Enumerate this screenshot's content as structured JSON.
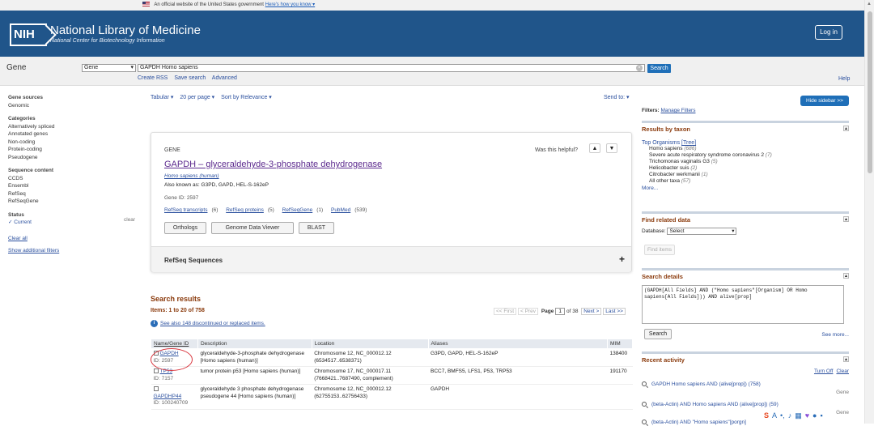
{
  "gov_banner": {
    "text": "An official website of the United States government",
    "link": "Here's how you know ▾"
  },
  "header": {
    "logo": "NIH",
    "title": "National Library of Medicine",
    "subtitle": "National Center for Biotechnology Information",
    "login": "Log in"
  },
  "search": {
    "db_title": "Gene",
    "db_select": "Gene",
    "query": "GAPDH Homo sapiens",
    "button": "Search",
    "links": [
      "Create RSS",
      "Save search",
      "Advanced"
    ],
    "help": "Help"
  },
  "sidebar": {
    "gene_sources": {
      "heading": "Gene sources",
      "items": [
        "Genomic"
      ]
    },
    "categories": {
      "heading": "Categories",
      "items": [
        "Alternatively spliced",
        "Annotated genes",
        "Non-coding",
        "Protein-coding",
        "Pseudogene"
      ]
    },
    "sequence": {
      "heading": "Sequence content",
      "items": [
        "CCDS",
        "Ensembl",
        "RefSeq",
        "RefSeqGene"
      ]
    },
    "status": {
      "heading": "Status",
      "clear": "clear",
      "current": "✓ Current"
    },
    "clear_all": "Clear all",
    "show_filters": "Show additional filters"
  },
  "toolbar": {
    "format": "Tabular ▾",
    "per_page": "20 per page ▾",
    "sort": "Sort by Relevance ▾",
    "send_to": "Send to: ▾"
  },
  "gene_card": {
    "label": "GENE",
    "helpful": "Was this helpful?",
    "title": "GAPDH – glyceraldehyde-3-phosphate dehydrogenase",
    "organism": "Homo sapiens (human)",
    "aliases": "Also known as: G3PD, GAPD, HEL-S-162eP",
    "gene_id": "Gene ID: 2597",
    "links": [
      {
        "label": "RefSeq transcripts",
        "count": "(6)"
      },
      {
        "label": "RefSeq proteins",
        "count": "(5)"
      },
      {
        "label": "RefSeqGene",
        "count": "(1)"
      },
      {
        "label": "PubMed",
        "count": "(539)"
      }
    ],
    "buttons": [
      "Orthologs",
      "Genome Data Viewer",
      "BLAST"
    ],
    "refseq_section": "RefSeq Sequences"
  },
  "results": {
    "heading": "Search results",
    "count": "Items: 1 to 20 of 758",
    "pager": {
      "first": "<< First",
      "prev": "< Prev",
      "page_label": "Page",
      "page": "1",
      "of": "of 38",
      "next": "Next >",
      "last": "Last >>"
    },
    "see_also": "See also 148 discontinued or replaced items.",
    "columns": [
      "Name/Gene ID",
      "Description",
      "Location",
      "Aliases",
      "MIM"
    ],
    "rows": [
      {
        "name": "GAPDH",
        "id": "ID: 2597",
        "desc": "glyceraldehyde-3-phosphate dehydrogenase [Homo sapiens (human)]",
        "loc": "Chromosome 12, NC_000012.12 (6534517..6538371)",
        "aliases": "G3PD, GAPD, HEL-S-162eP",
        "mim": "138400"
      },
      {
        "name": "TP53",
        "id": "ID: 7157",
        "desc": "tumor protein p53 [Homo sapiens (human)]",
        "loc": "Chromosome 17, NC_000017.11 (7668421..7687490, complement)",
        "aliases": "BCC7, BMFS5, LFS1, P53, TRP53",
        "mim": "191170"
      },
      {
        "name": "GAPDHP44",
        "id": "ID: 100240709",
        "desc": "glyceraldehyde 3 phosphate dehydrogenase pseudogene 44 [Homo sapiens (human)]",
        "loc": "Chromosome 12, NC_000012.12 (62755153..62756433)",
        "aliases": "GAPDH",
        "mim": ""
      }
    ]
  },
  "right": {
    "hide_sidebar": "Hide sidebar >>",
    "filters": "Filters:",
    "manage_filters": "Manage Filters",
    "taxon": {
      "heading": "Results by taxon",
      "top": "Top Organisms",
      "tree": "[Tree]",
      "items": [
        {
          "name": "Homo sapiens",
          "count": "(686)"
        },
        {
          "name": "Severe acute respiratory syndrome coronavirus 2",
          "count": "(7)"
        },
        {
          "name": "Trichomonas vaginalis G3",
          "count": "(5)"
        },
        {
          "name": "Helicobacter suis",
          "count": "(2)"
        },
        {
          "name": "Citrobacter werkmanii",
          "count": "(1)"
        },
        {
          "name": "All other taxa",
          "count": "(57)"
        }
      ],
      "more": "More..."
    },
    "related": {
      "heading": "Find related data",
      "db_label": "Database:",
      "db_value": "Select",
      "find": "Find items"
    },
    "details": {
      "heading": "Search details",
      "query": "(GAPDH[All Fields] AND (\"Homo sapiens\"[Organism] OR Homo sapiens[All Fields])) AND alive[prop]",
      "search": "Search",
      "see_more": "See more..."
    },
    "recent": {
      "heading": "Recent activity",
      "turn_off": "Turn Off",
      "clear": "Clear",
      "items": [
        {
          "text": "GAPDH Homo sapiens AND (alive[prop]) (758)",
          "db": "Gene"
        },
        {
          "text": "(beta-Actin) AND Homo sapiens AND (alive[prop]) (59)",
          "db": "Gene"
        },
        {
          "text": "(beta-Actin) AND \"Homo sapiens\"[porgn]",
          "db": ""
        }
      ]
    }
  },
  "colors": {
    "header_bg": "#20558a",
    "link": "#2a4f9e",
    "result_heading": "#8a3a0c",
    "highlight": "#d9363e",
    "button": "#1f6fb8"
  }
}
